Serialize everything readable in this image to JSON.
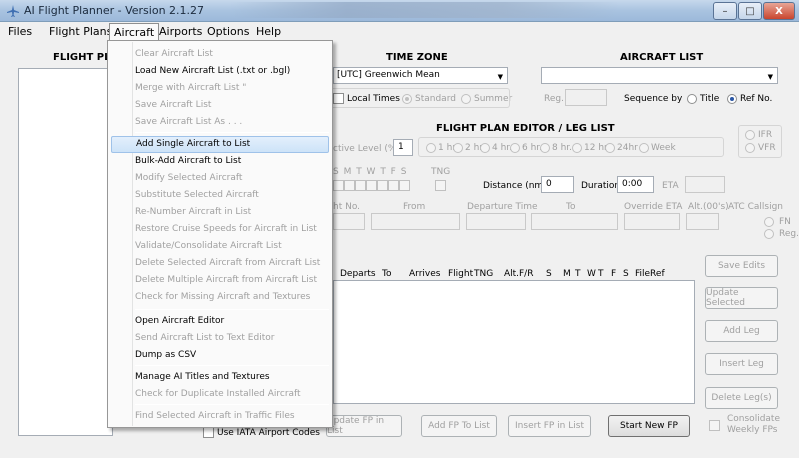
{
  "window": {
    "title": "AI Flight Planner - Version 2.1.27",
    "min_label": "–",
    "max_label": "□",
    "close_label": "X"
  },
  "menubar": {
    "items": [
      "Files",
      "Flight Plans",
      "Aircraft",
      "Airports",
      "Options",
      "Help"
    ]
  },
  "aircraft_menu": {
    "items": [
      {
        "label": "Clear Aircraft List",
        "enabled": false
      },
      {
        "label": "Load New Aircraft List (.txt or .bgl)",
        "enabled": true
      },
      {
        "label": "Merge with Aircraft List   \"",
        "enabled": false
      },
      {
        "label": "Save Aircraft List",
        "enabled": false
      },
      {
        "label": "Save Aircraft List As . . .",
        "enabled": false
      },
      {
        "label": "Add Single Aircraft to List",
        "enabled": true,
        "highlighted": true
      },
      {
        "label": "Bulk-Add Aircraft to List",
        "enabled": true
      },
      {
        "label": "Modify Selected Aircraft",
        "enabled": false
      },
      {
        "label": "Substitute Selected Aircraft",
        "enabled": false
      },
      {
        "label": "Re-Number Aircraft in List",
        "enabled": false
      },
      {
        "label": "Restore Cruise Speeds for Aircraft in List",
        "enabled": false
      },
      {
        "label": "Validate/Consolidate Aircraft List",
        "enabled": false
      },
      {
        "label": "Delete Selected Aircraft from Aircraft List",
        "enabled": false
      },
      {
        "label": "Delete Multiple Aircraft from Aircraft List",
        "enabled": false
      },
      {
        "label": "Check for Missing Aircraft and Textures",
        "enabled": false
      },
      {
        "label": "Open Aircraft Editor",
        "enabled": true
      },
      {
        "label": "Send Aircraft List to Text Editor",
        "enabled": false
      },
      {
        "label": "Dump as CSV",
        "enabled": true
      },
      {
        "label": "Manage AI Titles and Textures",
        "enabled": true
      },
      {
        "label": "Check for Duplicate Installed Aircraft",
        "enabled": false
      },
      {
        "label": "Find Selected Aircraft in Traffic Files",
        "enabled": false
      }
    ]
  },
  "flight_plans_panel": {
    "title": "FLIGHT PLA",
    "iata_label": "Use IATA Airport Codes"
  },
  "time_zone": {
    "title": "TIME ZONE",
    "selected": "[UTC] Greenwich Mean",
    "local_times": "Local Times",
    "standard": "Standard",
    "summer": "Summer"
  },
  "aircraft_list": {
    "title": "AIRCRAFT LIST",
    "selected": "",
    "reg_label": "Reg.",
    "sequence_label": "Sequence by",
    "title_opt": "Title",
    "refno_opt": "Ref No."
  },
  "editor": {
    "title": "FLIGHT PLAN EDITOR / LEG LIST",
    "active_level_label": "ctive Level (%)",
    "active_level_value": "1",
    "intervals": [
      "1 hr.",
      "2 hr.",
      "4 hr.",
      "6 hr.",
      "8 hr.",
      "12 hr",
      "24hr",
      "Week"
    ],
    "ifr": "IFR",
    "vfr": "VFR",
    "days_label": "S  M  T  W  T  F  S",
    "tng_label": "TNG",
    "distance_label": "Distance (nm)",
    "distance_value": "0",
    "duration_label": "Duration",
    "duration_value": "0:00",
    "eta_label": "ETA",
    "field_labels": {
      "flight_no": "ht No.",
      "from": "From",
      "departure_time": "Departure Time",
      "to": "To",
      "override_eta": "Override ETA",
      "alt": "Alt.(00's)",
      "atc_callsign": "ATC Callsign"
    },
    "fn_label": "FN",
    "reg_label": "Reg.",
    "columns": [
      "Departs",
      "To",
      "Arrives",
      "Flight",
      "TNG",
      "Alt.",
      "F/R",
      "S",
      "M",
      "T",
      "W",
      "T",
      "F",
      "S",
      "FileRef"
    ]
  },
  "right_buttons": [
    "Save Edits",
    "Update Selected",
    "Add Leg",
    "Insert Leg",
    "Delete Leg(s)"
  ],
  "consolidate": {
    "label1": "Consolidate",
    "label2": "Weekly FPs"
  },
  "bottom_buttons": {
    "update_fp": "Update FP in List",
    "add_fp": "Add FP To List",
    "insert_fp": "Insert FP in List",
    "start_new": "Start New FP"
  }
}
